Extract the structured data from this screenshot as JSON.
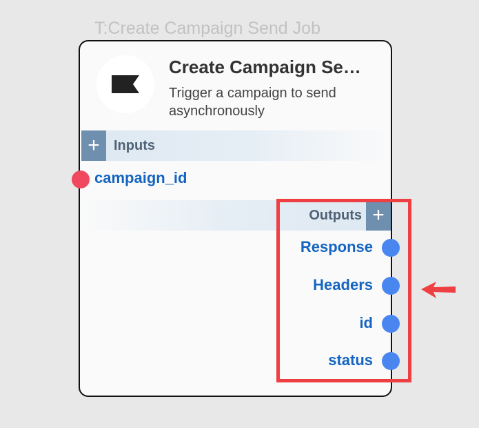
{
  "node": {
    "type_label": "T:Create Campaign Send Job",
    "title": "Create Campaign Se…",
    "description": "Trigger a campaign to send asynchronously",
    "icon": "flag-icon",
    "inputs_section": {
      "label": "Inputs",
      "add_label": "+"
    },
    "inputs": [
      {
        "label": "campaign_id"
      }
    ],
    "outputs_section": {
      "label": "Outputs",
      "add_label": "+"
    },
    "outputs": [
      {
        "label": "Response"
      },
      {
        "label": "Headers"
      },
      {
        "label": "id"
      },
      {
        "label": "status"
      }
    ]
  },
  "annotation": {
    "highlight_color": "#ee3f43",
    "arrow_icon": "arrow-left-icon"
  },
  "colors": {
    "input_port": "#f0495f",
    "output_port": "#4a86f0",
    "port_label": "#1565c0",
    "section_button": "#6f8faf"
  }
}
